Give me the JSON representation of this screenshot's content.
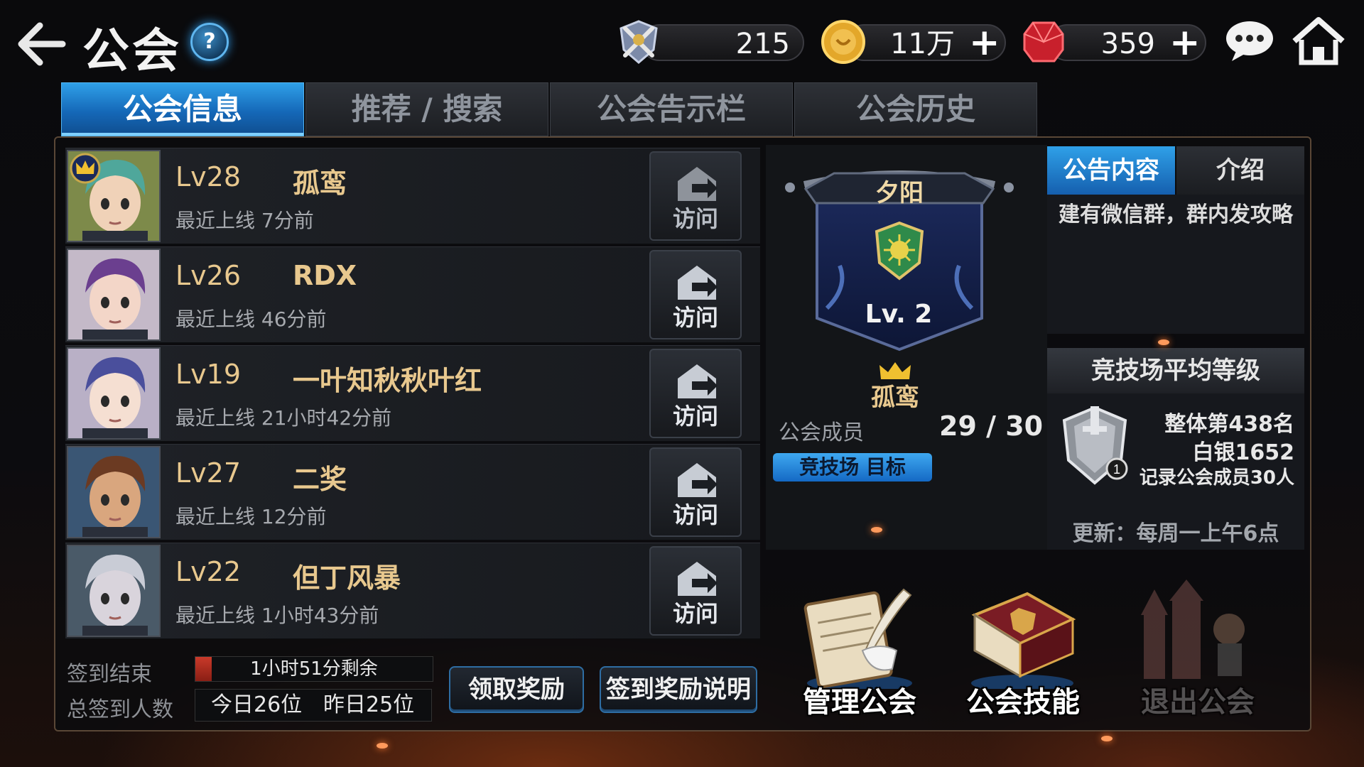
{
  "header": {
    "title": "公会",
    "help_label": "?",
    "resources": [
      {
        "name": "arena-medal-icon",
        "value": "215"
      },
      {
        "name": "gold-coin-icon",
        "value": "11万"
      },
      {
        "name": "ruby-gem-icon",
        "value": "359"
      }
    ],
    "plus_label": "+"
  },
  "tabs": [
    {
      "label": "公会信息",
      "active": true
    },
    {
      "label": "推荐 / 搜索",
      "active": false
    },
    {
      "label": "公会告示栏",
      "active": false
    },
    {
      "label": "公会历史",
      "active": false
    }
  ],
  "members": [
    {
      "level": "Lv28",
      "name": "孤鸾",
      "online": "最近上线 7分前",
      "visit": "访问",
      "is_leader": true,
      "hair": "#4fa79b",
      "skin": "#f0d2b8",
      "bg": "#7d8a4a"
    },
    {
      "level": "Lv26",
      "name": "RDX",
      "online": "最近上线 46分前",
      "visit": "访问",
      "is_leader": false,
      "hair": "#6b3f8f",
      "skin": "#f3d6c8",
      "bg": "#c4b9c8"
    },
    {
      "level": "Lv19",
      "name": "一叶知秋秋叶红",
      "online": "最近上线 21小时42分前",
      "visit": "访问",
      "is_leader": false,
      "hair": "#4a4f9c",
      "skin": "#f5dfd2",
      "bg": "#b9b0c6"
    },
    {
      "level": "Lv27",
      "name": "二奖",
      "online": "最近上线 12分前",
      "visit": "访问",
      "is_leader": false,
      "hair": "#6b3a22",
      "skin": "#d9a67e",
      "bg": "#3a5674"
    },
    {
      "level": "Lv22",
      "name": "但丁风暴",
      "online": "最近上线 1小时43分前",
      "visit": "访问",
      "is_leader": false,
      "hair": "#c9ccd6",
      "skin": "#d9d4dc",
      "bg": "#4a5a68"
    }
  ],
  "signin": {
    "end_label": "签到结束",
    "remaining_text": "1小时51分剩余",
    "remaining_fraction": 0.07,
    "total_label": "总签到人数",
    "today": "今日26位",
    "yesterday": "昨日25位",
    "claim_button": "领取奖励",
    "info_button": "签到奖励说明"
  },
  "guild": {
    "name": "夕阳",
    "level": "Lv. 2",
    "leader": "孤鸾",
    "members_label": "公会成员",
    "members_value": "29 / 30",
    "arena_tag": "竞技场 目标"
  },
  "notice": {
    "tab_content": "公告内容",
    "tab_intro": "介绍",
    "text": "建有微信群，群内发攻略"
  },
  "arena_rank": {
    "title": "竞技场平均等级",
    "overall": "整体第438名",
    "tier": "白银1652",
    "recorded": "记录公会成员30人",
    "badge_number": "1",
    "update": "更新：每周一上午6点"
  },
  "actions": [
    {
      "label": "管理公会",
      "enabled": true
    },
    {
      "label": "公会技能",
      "enabled": true
    },
    {
      "label": "退出公会",
      "enabled": false
    }
  ]
}
